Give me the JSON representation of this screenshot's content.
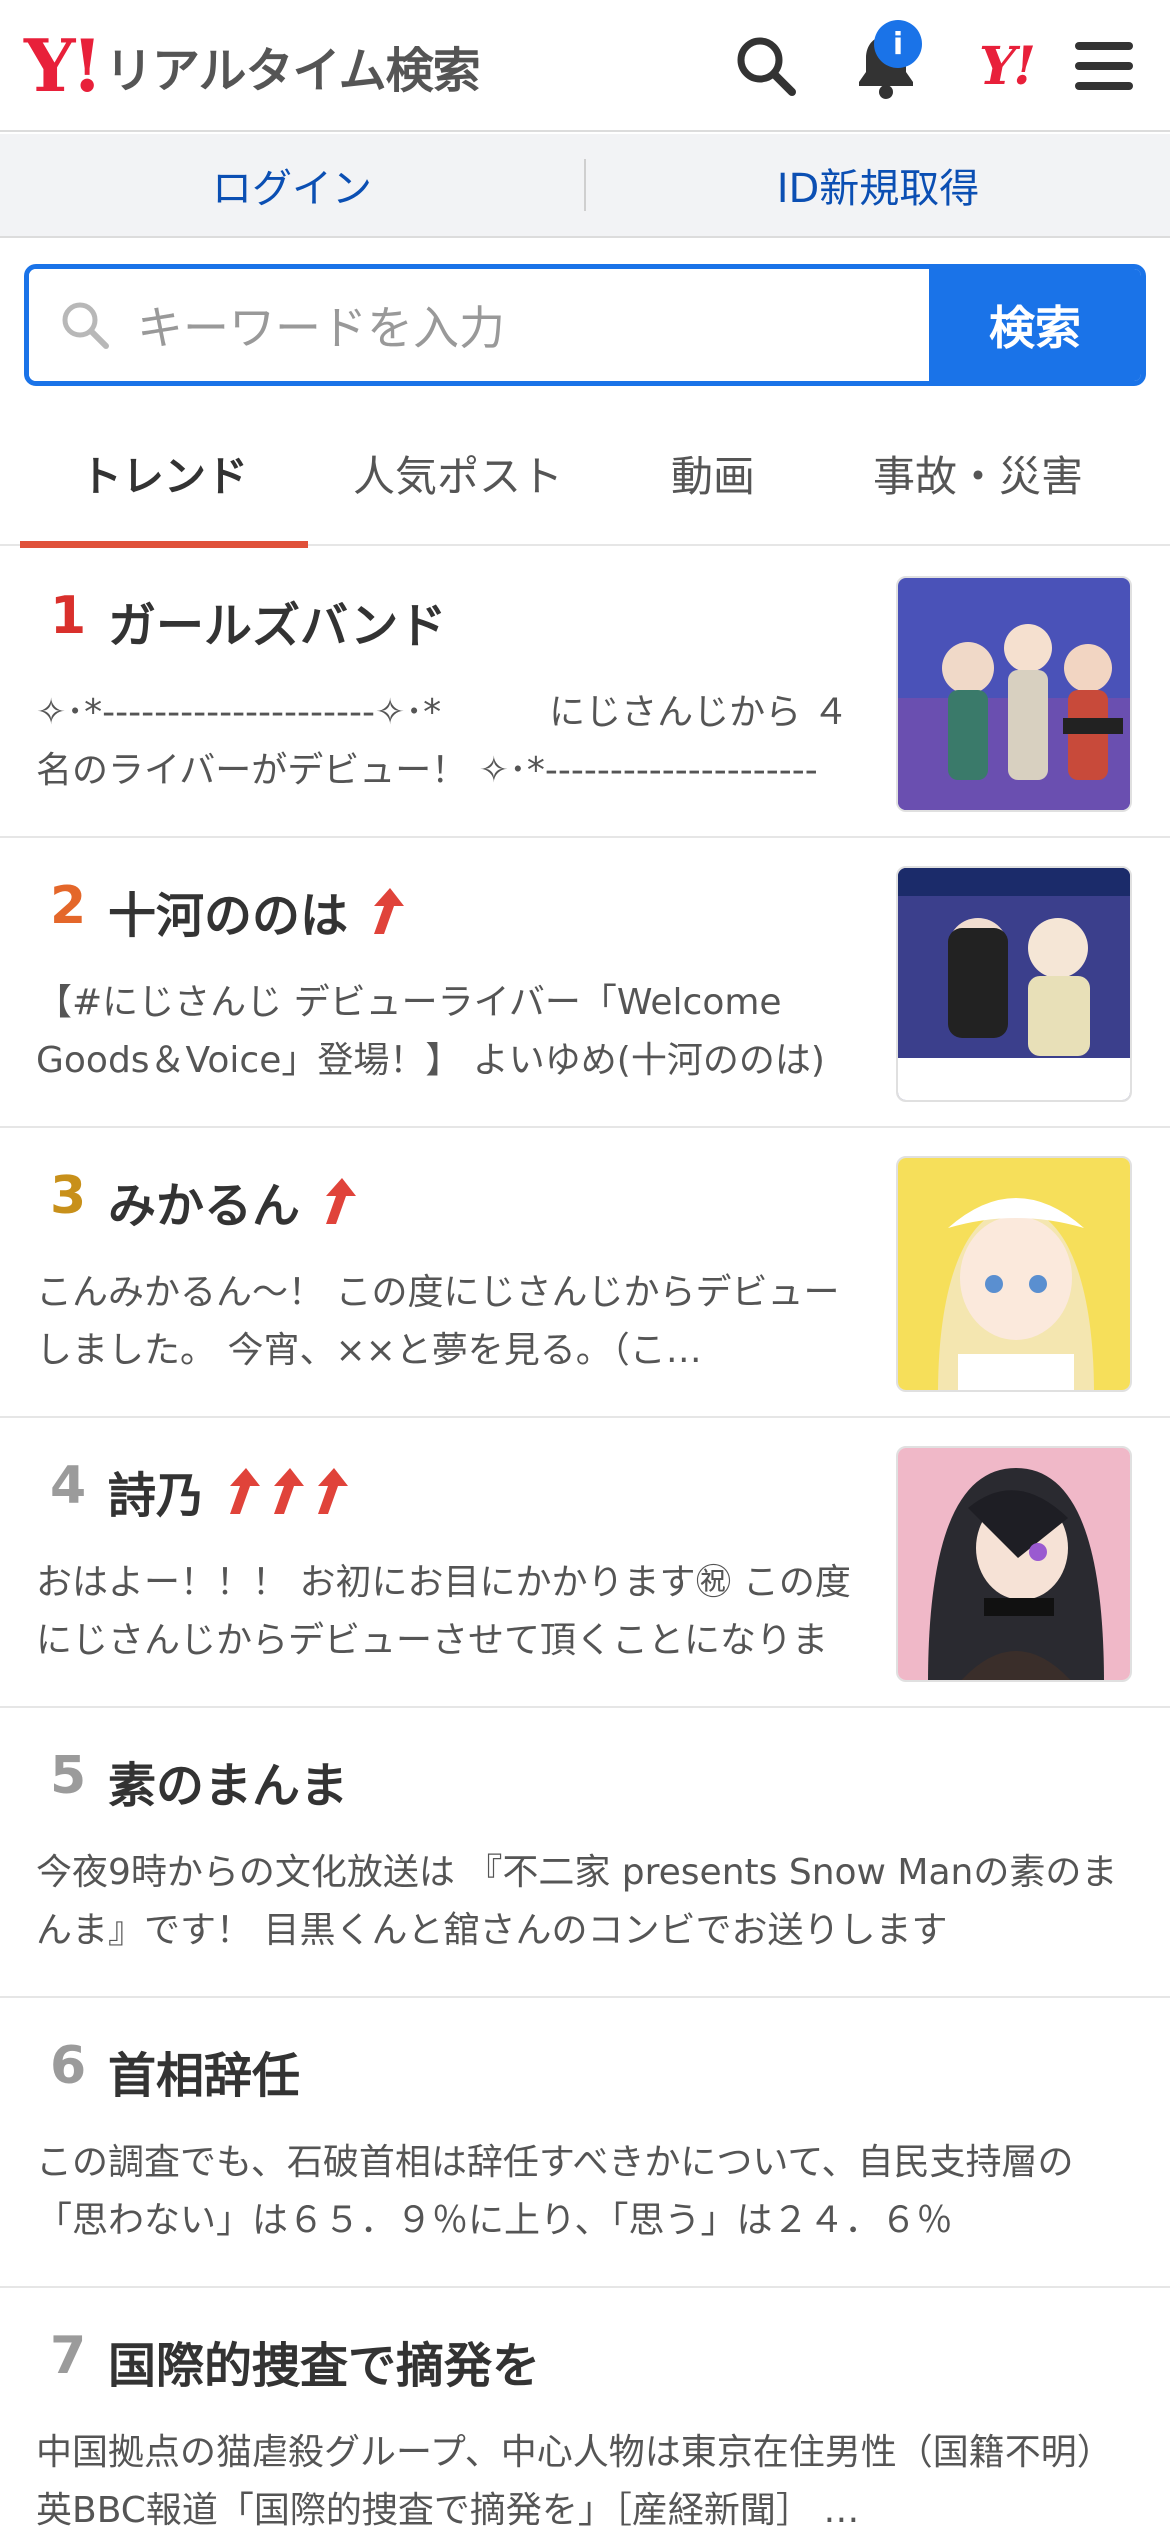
{
  "header": {
    "logo_mark": "Y!",
    "logo_text": "リアルタイム検索",
    "notification_badge": "i",
    "yahoo_mark": "Y!"
  },
  "login_bar": {
    "login": "ログイン",
    "signup": "ID新規取得"
  },
  "search": {
    "placeholder": "キーワードを入力",
    "button": "検索"
  },
  "tabs": [
    "トレンド",
    "人気ポスト",
    "動画",
    "事故・災害"
  ],
  "colors": {
    "accent_blue": "#1a73e8",
    "tab_underline": "#e0513a",
    "rank_1": "#d9302c",
    "rank_2": "#e4672a",
    "rank_3": "#c8901a",
    "rank_other": "#9b9b9b",
    "trend_arrow": "#e0433a"
  },
  "trends": [
    {
      "rank": "1",
      "title": "ガールズバンド",
      "arrows": 0,
      "snippet": "✧･*---------------------✧･*　　　にじさんじから ４名のライバーがデビュー！ ✧･*---------------------✧･*",
      "has_image": true
    },
    {
      "rank": "2",
      "title": "十河ののは",
      "arrows": 1,
      "snippet": "【#にじさんじ デビューライバー「Welcome Goods＆Voice」登場！】 よいゆめ(十河ののは)",
      "has_image": true
    },
    {
      "rank": "3",
      "title": "みかるん",
      "arrows": 1,
      "snippet": "こんみかるん〜！ この度にじさんじからデビューしました。 今宵、××と夢を見る。（こ…",
      "has_image": true
    },
    {
      "rank": "4",
      "title": "詩乃",
      "arrows": 3,
      "snippet": "おはよー！！！ お初にお目にかかります㊗ この度にじさんじからデビューさせて頂くことになりました",
      "has_image": true
    },
    {
      "rank": "5",
      "title": "素のまんま",
      "arrows": 0,
      "snippet": "今夜9時からの文化放送は 『不二家 presents Snow Manの素のまんま』です！ 目黒くんと舘さんのコンビでお送りします",
      "has_image": false
    },
    {
      "rank": "6",
      "title": "首相辞任",
      "arrows": 0,
      "snippet": "この調査でも、石破首相は辞任すべきかについて、自民支持層の「思わない」は６５．９％に上り、「思う」は２４．６％",
      "has_image": false
    },
    {
      "rank": "7",
      "title": "国際的捜査で摘発を",
      "arrows": 0,
      "snippet": "中国拠点の猫虐殺グループ、中心人物は東京在住男性（国籍不明） 英BBC報道「国際的捜査で摘発を」［産経新聞］ …",
      "has_image": false
    }
  ]
}
